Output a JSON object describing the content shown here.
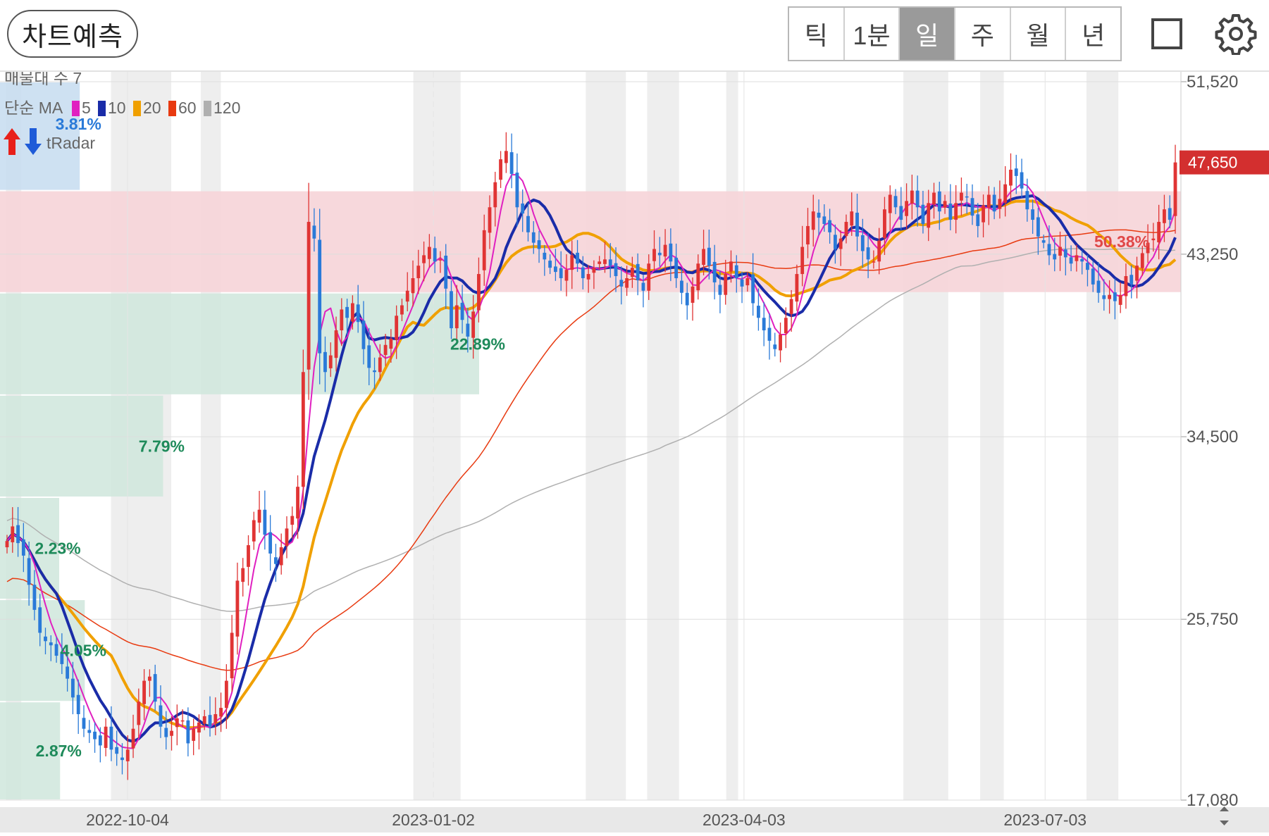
{
  "header": {
    "predict_label": "차트예측",
    "periods": [
      "틱",
      "1분",
      "일",
      "주",
      "월",
      "년"
    ],
    "active_period": "일",
    "square_icon": "square-icon",
    "settings_icon": "gear-icon"
  },
  "legend": {
    "volume_profile_label": "매물대 수 7",
    "ma_label": "단순 MA",
    "ma_periods": [
      {
        "label": "5",
        "color": "#e020c0"
      },
      {
        "label": "10",
        "color": "#1a2ca8"
      },
      {
        "label": "20",
        "color": "#f0a000"
      },
      {
        "label": "60",
        "color": "#e83a10"
      },
      {
        "label": "120",
        "color": "#b0b0b0"
      }
    ],
    "tradar_label": "tRadar"
  },
  "chart_data": {
    "type": "candlestick",
    "y_axis": {
      "ylim": [
        17080,
        51520
      ],
      "ticks": [
        "51,520",
        "43,250",
        "34,500",
        "25,750",
        "17,080"
      ]
    },
    "x_axis": {
      "ticks": [
        "2022-10-04",
        "2023-01-02",
        "2023-04-03",
        "2023-07-03"
      ]
    },
    "current_price": "47,650",
    "current_price_value": 47650,
    "colors": {
      "up": "#e03434",
      "down": "#2a7ad8",
      "price_tag": "#d32f2f",
      "profile": "#cfe6dc",
      "profile_max": "#f6d4d8"
    },
    "volume_profile": [
      {
        "low": 46300,
        "high": 51520,
        "pct": "3.81%",
        "value": 3.81
      },
      {
        "low": 41400,
        "high": 46300,
        "pct": "50.38%",
        "value": 50.38
      },
      {
        "low": 36500,
        "high": 41400,
        "pct": "22.89%",
        "value": 22.89
      },
      {
        "low": 31600,
        "high": 36500,
        "pct": "7.79%",
        "value": 7.79
      },
      {
        "low": 26700,
        "high": 31600,
        "pct": "2.23%",
        "value": 2.23
      },
      {
        "low": 21800,
        "high": 26700,
        "pct": "4.05%",
        "value": 4.05
      },
      {
        "low": 17080,
        "high": 21800,
        "pct": "2.87%",
        "value": 2.87
      }
    ],
    "closes": [
      29500,
      30200,
      29400,
      28800,
      27400,
      26200,
      25100,
      24700,
      24500,
      24000,
      23600,
      22900,
      22000,
      21200,
      20500,
      20300,
      20000,
      19700,
      20600,
      19500,
      19300,
      19000,
      19500,
      20500,
      21800,
      22800,
      23000,
      21800,
      20600,
      20100,
      20400,
      21000,
      20900,
      19800,
      20500,
      20800,
      21100,
      20600,
      21200,
      21500,
      22800,
      25100,
      27600,
      28200,
      29300,
      30500,
      31000,
      29800,
      28900,
      28400,
      29200,
      30100,
      30700,
      32100,
      37600,
      44800,
      44000,
      38500,
      37600,
      38400,
      39600,
      40600,
      40200,
      40900,
      40000,
      38700,
      37800,
      37600,
      38300,
      38900,
      39200,
      40300,
      40800,
      41500,
      42100,
      42700,
      43200,
      43600,
      42900,
      43000,
      41600,
      39700,
      40800,
      40100,
      39300,
      40500,
      42300,
      44400,
      45500,
      46700,
      47800,
      48200,
      47100,
      45500,
      45200,
      44300,
      43800,
      43500,
      43000,
      42600,
      42400,
      42100,
      42500,
      43200,
      42800,
      42100,
      42300,
      42600,
      42900,
      43000,
      42700,
      42200,
      41700,
      42100,
      42600,
      42000,
      41500,
      42800,
      43500,
      43200,
      43700,
      42900,
      42100,
      41400,
      40800,
      41700,
      42800,
      43500,
      42700,
      41900,
      41300,
      42300,
      42900,
      42100,
      41700,
      42100,
      40900,
      40200,
      39600,
      39100,
      38700,
      39400,
      40200,
      41100,
      42300,
      43600,
      44600,
      45300,
      45000,
      44700,
      44300,
      43500,
      44000,
      44800,
      45300,
      44100,
      43400,
      43000,
      42900,
      43900,
      45400,
      46100,
      45500,
      44900,
      45800,
      46300,
      45500,
      44700,
      45700,
      46200,
      45300,
      45800,
      44900,
      45700,
      46200,
      46000,
      45100,
      44600,
      45600,
      46100,
      45300,
      45900,
      46600,
      47300,
      47000,
      46400,
      45400,
      44900,
      44100,
      43800,
      43200,
      43000,
      43600,
      43100,
      42800,
      43200,
      42900,
      42500,
      41800,
      41400,
      41100,
      41300,
      41000,
      41300,
      42200,
      41800,
      42700,
      43300,
      43800,
      44000,
      44800,
      45400,
      44900,
      47650
    ]
  }
}
